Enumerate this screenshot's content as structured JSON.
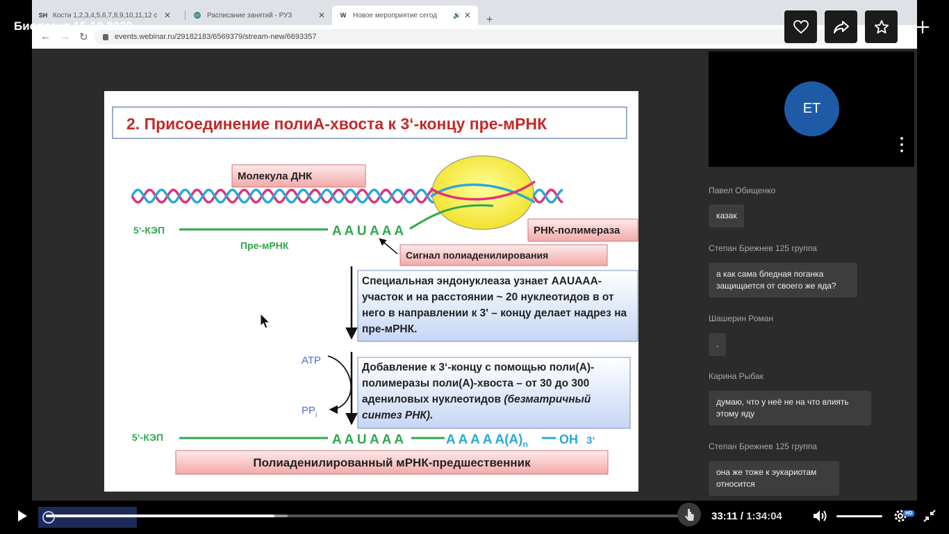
{
  "browser": {
    "tabs": [
      {
        "favicon": "SH",
        "label": "Кости 1,2,3,4,5,6,7,8,9,10,11,12 с"
      },
      {
        "favicon": "globe",
        "label": "Расписание занятий - РУЗ"
      },
      {
        "favicon": "W",
        "label": "Новое мероприятие сегод"
      }
    ],
    "url": "events.webinar.ru/29182183/6569379/stream-new/6693357"
  },
  "video_title": "Биология 15.10.2020",
  "slide": {
    "heading": "2. Присоединение полиА-хвоста к 3‘-концу пре-мРНК",
    "dna_label": "Молекула ДНК",
    "five_cap_1": "5‘-КЭП",
    "seq_1": "A A U A A A",
    "pre_mrna": "Пре-мРНК",
    "polymerase": "РНК-полимераза",
    "signal": "Сигнал полиаденилирования",
    "box1": "Специальная эндонуклеаза узнает AAUAAA-участок и на расстоянии  ~ 20 нуклеотидов в от него в направлении к 3' – концу  делает надрез на пре-мРНК.",
    "atp": "ATP",
    "ppi": "PP",
    "ppi_sub": "i",
    "box2_a": "Добавление к 3‘-концу с помощью  поли(А)-полимеразы поли(А)-хвоста  –  от 30 до 300 адениловых нуклеотидов ",
    "box2_b": "(безматричный синтез РНК).",
    "five_cap_2": "5‘-КЭП",
    "seq_2": "A A U A A A",
    "poly_a": "A A A A A(A)",
    "poly_n": "n",
    "oh": "OH",
    "three": "3‘",
    "footer": "Полиаденилированный мРНК-предшественник"
  },
  "participant": {
    "initials": "ET"
  },
  "chat": [
    {
      "author": "Павел Обищенко",
      "text": "казак"
    },
    {
      "author": "Степан Брежнев 125 группа",
      "text": "а как сама бледная поганка защищается от своего же яда?"
    },
    {
      "author": "Шашерин Роман",
      "text": "."
    },
    {
      "author": "Карина Рыбак",
      "text": "думаю, что у неё не на что влиять этому яду"
    },
    {
      "author": "Степан Брежнев 125 группа",
      "text": "она же тоже к эукариотам относится"
    }
  ],
  "player": {
    "current_time": "33:11",
    "separator": " / ",
    "duration": "1:34:04",
    "played_fraction": 0.36,
    "buffered_fraction": 0.38,
    "hd_badge": "HD",
    "volume_fraction": 1.0
  },
  "colors": {
    "accent_blue": "#1f5aa6",
    "slide_heading": "#c62828",
    "rna_green": "#2ea84a"
  }
}
